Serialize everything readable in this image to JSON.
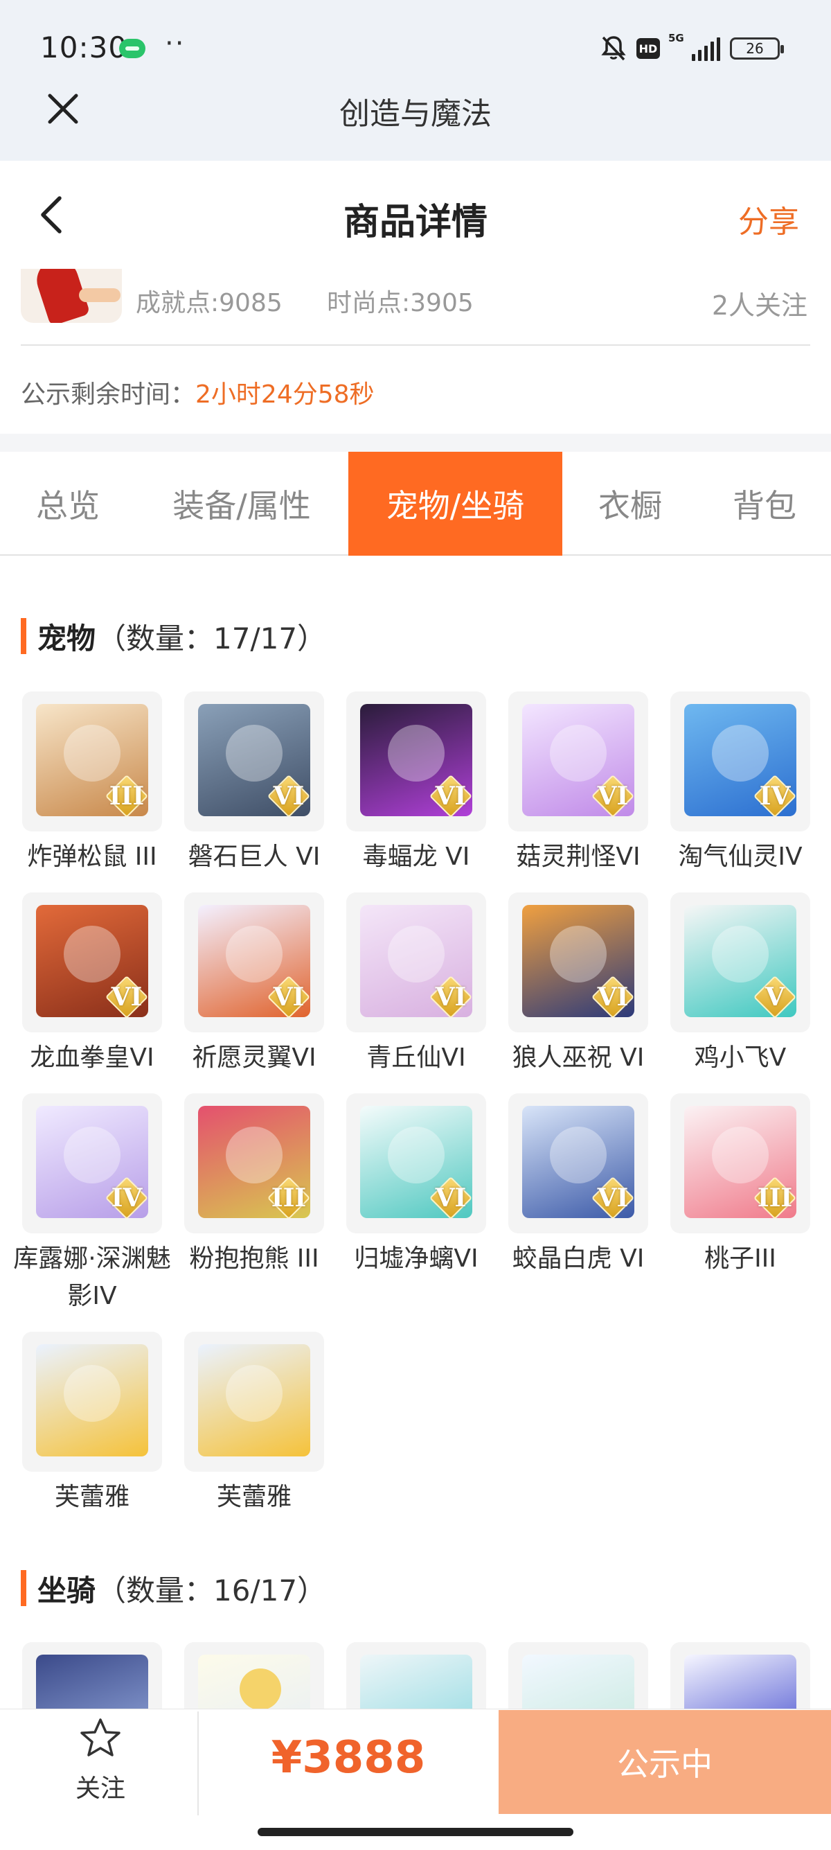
{
  "status_bar": {
    "time": "10:30",
    "dots": "··",
    "network": "5G",
    "hd": "HD",
    "battery": "26"
  },
  "app_bar": {
    "title": "创造与魔法"
  },
  "header": {
    "title": "商品详情",
    "share": "分享"
  },
  "account": {
    "achievement": "成就点:9085",
    "fashion": "时尚点:3905",
    "watchers": "2人关注"
  },
  "countdown": {
    "label": "公示剩余时间：",
    "value": "2小时24分58秒"
  },
  "tabs": [
    {
      "label": "总览",
      "active": false
    },
    {
      "label": "装备/属性",
      "active": false
    },
    {
      "label": "宠物/坐骑",
      "active": true
    },
    {
      "label": "衣橱",
      "active": false
    },
    {
      "label": "背包",
      "active": false
    }
  ],
  "pets": {
    "name": "宠物",
    "count": "（数量：17/17）",
    "items": [
      {
        "name": "炸弹松鼠 III",
        "tier": "III"
      },
      {
        "name": "磐石巨人 VI",
        "tier": "VI"
      },
      {
        "name": "毒蝠龙 VI",
        "tier": "VI"
      },
      {
        "name": "菇灵荆怪VI",
        "tier": "VI"
      },
      {
        "name": "淘气仙灵IV",
        "tier": "IV"
      },
      {
        "name": "龙血拳皇VI",
        "tier": "VI"
      },
      {
        "name": "祈愿灵翼VI",
        "tier": "VI"
      },
      {
        "name": "青丘仙VI",
        "tier": "VI"
      },
      {
        "name": "狼人巫祝 VI",
        "tier": "VI"
      },
      {
        "name": "鸡小飞V",
        "tier": "V"
      },
      {
        "name": "库露娜·深渊魅影IV",
        "tier": "IV"
      },
      {
        "name": "粉抱抱熊 III",
        "tier": "III"
      },
      {
        "name": "归墟净螭VI",
        "tier": "VI"
      },
      {
        "name": "蛟晶白虎 VI",
        "tier": "VI"
      },
      {
        "name": "桃子III",
        "tier": "III"
      },
      {
        "name": "芙蕾雅",
        "tier": ""
      },
      {
        "name": "芙蕾雅",
        "tier": ""
      }
    ]
  },
  "mounts": {
    "name": "坐骑",
    "count": "（数量：16/17）"
  },
  "bottom": {
    "follow": "关注",
    "price": "¥3888",
    "status_button": "公示中"
  },
  "colors": {
    "accent": "#ff6a22",
    "price": "#f0632b",
    "button": "#f8ac82"
  }
}
